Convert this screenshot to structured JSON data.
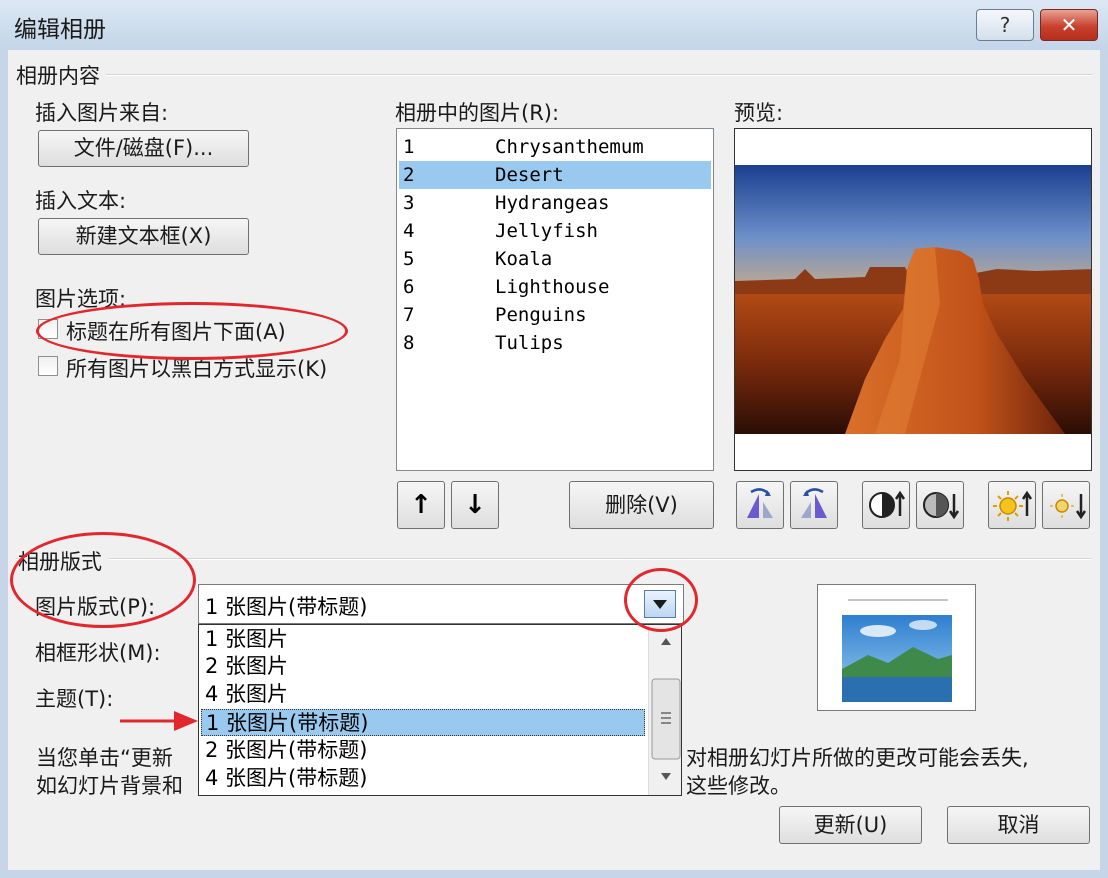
{
  "window": {
    "title": "编辑相册",
    "help_label": "?",
    "close_label": "✕"
  },
  "album_content": {
    "group_label": "相册内容",
    "insert_picture_label": "插入图片来自:",
    "file_disk_button": "文件/磁盘(F)...",
    "insert_text_label": "插入文本:",
    "new_textbox_button": "新建文本框(X)",
    "picture_options_label": "图片选项:",
    "captions_below_label": "标题在所有图片下面(A)",
    "black_white_label": "所有图片以黑白方式显示(K)"
  },
  "pictures_list": {
    "label": "相册中的图片(R):",
    "items": [
      {
        "num": "1",
        "name": "Chrysanthemum"
      },
      {
        "num": "2",
        "name": "Desert"
      },
      {
        "num": "3",
        "name": "Hydrangeas"
      },
      {
        "num": "4",
        "name": "Jellyfish"
      },
      {
        "num": "5",
        "name": "Koala"
      },
      {
        "num": "6",
        "name": "Lighthouse"
      },
      {
        "num": "7",
        "name": "Penguins"
      },
      {
        "num": "8",
        "name": "Tulips"
      }
    ],
    "selected_index": 1,
    "move_up_label": "↑",
    "move_down_label": "↓",
    "delete_button": "删除(V)"
  },
  "preview": {
    "label": "预览:"
  },
  "album_layout": {
    "group_label": "相册版式",
    "picture_layout_label": "图片版式(P):",
    "picture_layout_value": "1 张图片(带标题)",
    "frame_shape_label": "相框形状(M):",
    "theme_label": "主题(T):",
    "dropdown_options": [
      "1 张图片",
      "2 张图片",
      "4 张图片",
      "1 张图片(带标题)",
      "2 张图片(带标题)",
      "4 张图片(带标题)"
    ],
    "dropdown_selected_index": 3
  },
  "footer": {
    "note_line1_left": "当您单击“更新",
    "note_line1_right": "对相册幻灯片所做的更改可能会丢失,",
    "note_line2_left": "如幻灯片背景和",
    "note_line2_right": "这些修改。",
    "update_button": "更新(U)",
    "cancel_button": "取消"
  },
  "colors": {
    "selection": "#99c9ef",
    "annotation": "#e0282e"
  }
}
